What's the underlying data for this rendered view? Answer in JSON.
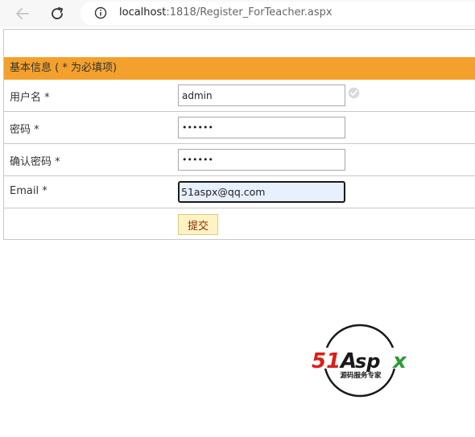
{
  "browser": {
    "url_host": "localhost",
    "url_rest": ":1818/Register_ForTeacher.aspx"
  },
  "form": {
    "header": "基本信息 ( * 为必填项)",
    "rows": [
      {
        "label": "用户名 *",
        "value": "admin",
        "type": "text"
      },
      {
        "label": "密码 *",
        "value": "••••••",
        "type": "password"
      },
      {
        "label": "确认密码 *",
        "value": "••••••",
        "type": "password"
      },
      {
        "label": "Email *",
        "value": "51aspx@qq.com",
        "type": "text"
      }
    ],
    "submit_label": "提交"
  },
  "logo": {
    "brand_red": "51",
    "brand_a": "A",
    "brand_sp": "sp",
    "brand_x": "x",
    "tagline": "源码服务专家",
    "colors": {
      "red": "#d7211b",
      "green": "#2e9b3a",
      "dark": "#1a1a1a"
    }
  },
  "icons": [
    "back-arrow-icon",
    "reload-icon",
    "info-icon",
    "check-circle-icon"
  ]
}
